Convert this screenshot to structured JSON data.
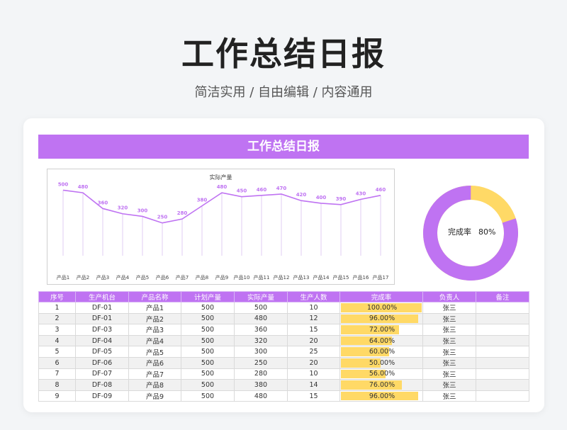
{
  "page": {
    "title": "工作总结日报",
    "subtitle": "简洁实用 / 自由编辑 / 内容通用"
  },
  "report": {
    "banner": "工作总结日报"
  },
  "chart_data": [
    {
      "type": "line",
      "title": "实际产量",
      "categories": [
        "产品1",
        "产品2",
        "产品3",
        "产品4",
        "产品5",
        "产品6",
        "产品7",
        "产品8",
        "产品9",
        "产品10",
        "产品11",
        "产品12",
        "产品13",
        "产品14",
        "产品15",
        "产品16",
        "产品17"
      ],
      "values": [
        500,
        480,
        360,
        320,
        300,
        250,
        280,
        380,
        480,
        450,
        460,
        470,
        420,
        400,
        390,
        430,
        460
      ],
      "ylim": [
        0,
        540
      ],
      "color": "#bf73f2",
      "grid": false,
      "data_labels": true
    },
    {
      "type": "pie",
      "subtype": "donut",
      "label": "完成率",
      "value_text": "80%",
      "value": 0.8,
      "colors": {
        "done": "#bf73f2",
        "remaining": "#ffd966"
      }
    }
  ],
  "table": {
    "headers": [
      "序号",
      "生产机台",
      "产品名称",
      "计划产量",
      "实际产量",
      "生产人数",
      "完成率",
      "负责人",
      "备注"
    ],
    "rows": [
      {
        "no": "1",
        "machine": "DF-01",
        "product": "产品1",
        "plan": "500",
        "actual": "500",
        "workers": "10",
        "rate": "100.00%",
        "rate_value": 1.0,
        "owner": "张三",
        "note": ""
      },
      {
        "no": "2",
        "machine": "DF-01",
        "product": "产品2",
        "plan": "500",
        "actual": "480",
        "workers": "12",
        "rate": "96.00%",
        "rate_value": 0.96,
        "owner": "张三",
        "note": ""
      },
      {
        "no": "3",
        "machine": "DF-03",
        "product": "产品3",
        "plan": "500",
        "actual": "360",
        "workers": "15",
        "rate": "72.00%",
        "rate_value": 0.72,
        "owner": "张三",
        "note": ""
      },
      {
        "no": "4",
        "machine": "DF-04",
        "product": "产品4",
        "plan": "500",
        "actual": "320",
        "workers": "20",
        "rate": "64.00%",
        "rate_value": 0.64,
        "owner": "张三",
        "note": ""
      },
      {
        "no": "5",
        "machine": "DF-05",
        "product": "产品5",
        "plan": "500",
        "actual": "300",
        "workers": "25",
        "rate": "60.00%",
        "rate_value": 0.6,
        "owner": "张三",
        "note": ""
      },
      {
        "no": "6",
        "machine": "DF-06",
        "product": "产品6",
        "plan": "500",
        "actual": "250",
        "workers": "20",
        "rate": "50.00%",
        "rate_value": 0.5,
        "owner": "张三",
        "note": ""
      },
      {
        "no": "7",
        "machine": "DF-07",
        "product": "产品7",
        "plan": "500",
        "actual": "280",
        "workers": "10",
        "rate": "56.00%",
        "rate_value": 0.56,
        "owner": "张三",
        "note": ""
      },
      {
        "no": "8",
        "machine": "DF-08",
        "product": "产品8",
        "plan": "500",
        "actual": "380",
        "workers": "14",
        "rate": "76.00%",
        "rate_value": 0.76,
        "owner": "张三",
        "note": ""
      },
      {
        "no": "9",
        "machine": "DF-09",
        "product": "产品9",
        "plan": "500",
        "actual": "480",
        "workers": "15",
        "rate": "96.00%",
        "rate_value": 0.96,
        "owner": "张三",
        "note": ""
      }
    ]
  },
  "colors": {
    "accent": "#bf73f2",
    "bar": "#ffd966"
  }
}
